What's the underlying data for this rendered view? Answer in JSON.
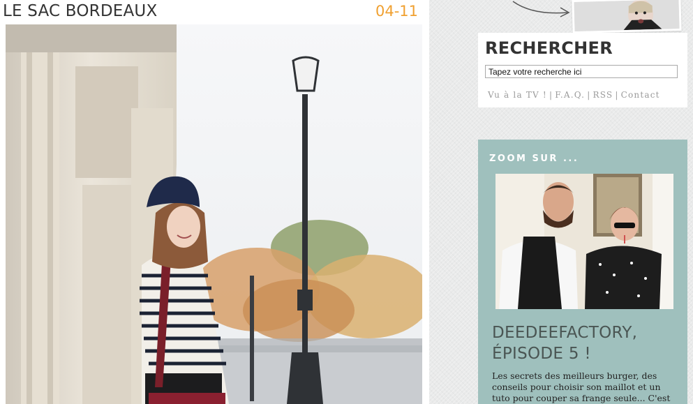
{
  "post": {
    "title": "LE SAC BORDEAUX",
    "date": "04-11"
  },
  "sidebar": {
    "search": {
      "title": "RECHERCHER",
      "placeholder": "Tapez votre recherche ici",
      "value": "Tapez votre recherche ici",
      "links": [
        "Vu à la TV !",
        "F.A.Q.",
        "RSS",
        "Contact"
      ]
    },
    "zoom": {
      "heading": "ZOOM SUR ...",
      "title": "DEEDEEFACTORY, ÉPISODE 5 !",
      "excerpt": "Les secrets des meilleurs burger, des conseils pour choisir son maillot et un tuto pour couper sa frange seule... C'est"
    }
  },
  "colors": {
    "date_accent": "#f0a030",
    "zoom_background": "#9fc0bd",
    "sidebar_background": "#e9eaea"
  },
  "icons": {
    "arrow": "hand-drawn-arrow-icon"
  }
}
